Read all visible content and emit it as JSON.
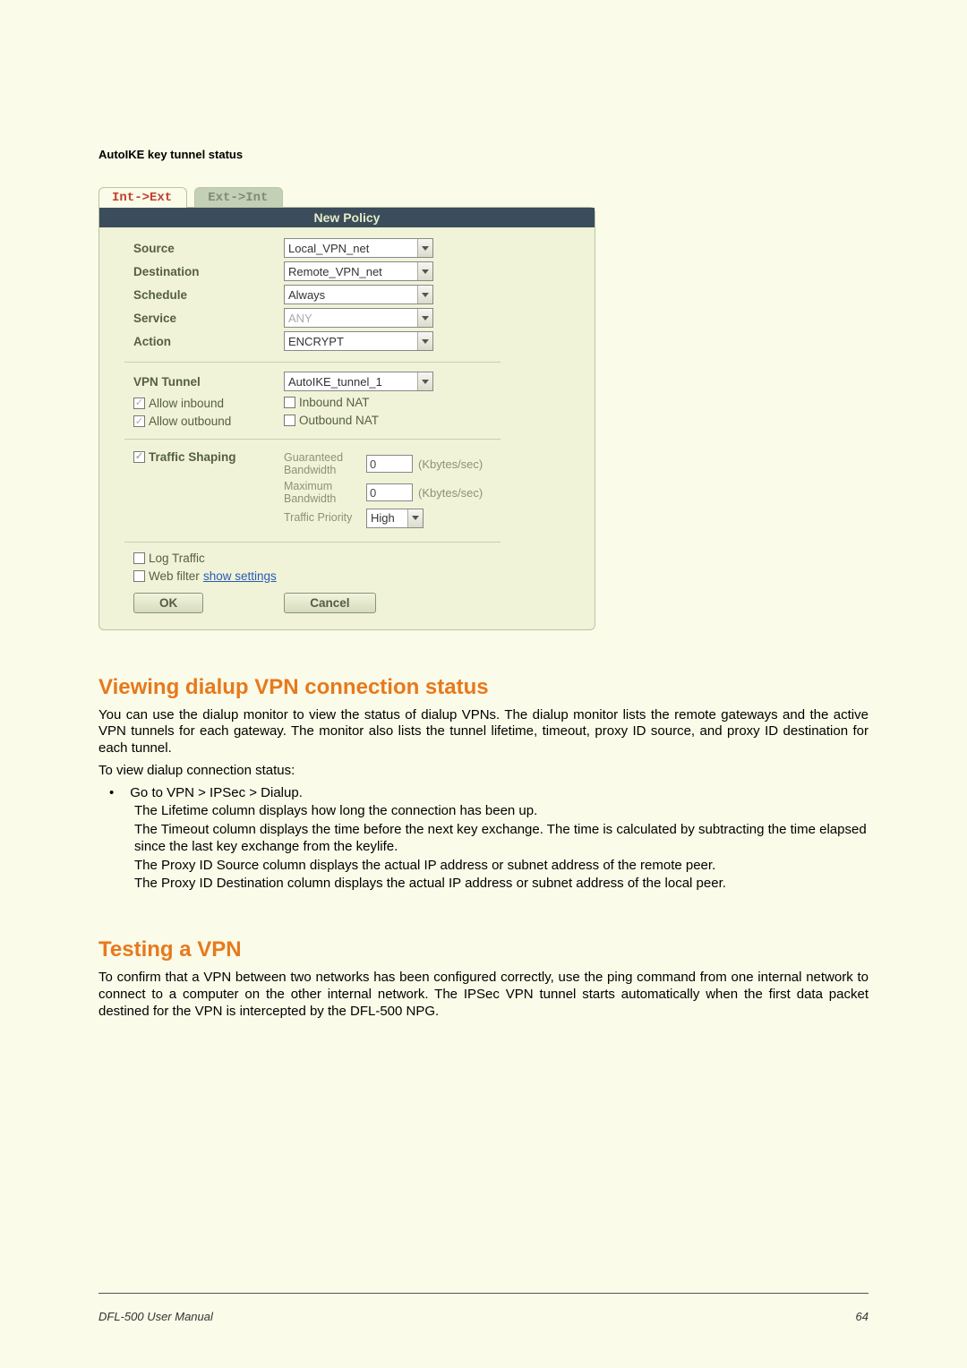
{
  "caption": "AutoIKE key tunnel status",
  "tabs": {
    "active": "Int->Ext",
    "inactive": "Ext->Int"
  },
  "panel_title": "New Policy",
  "fields": {
    "source": {
      "label": "Source",
      "value": "Local_VPN_net"
    },
    "destination": {
      "label": "Destination",
      "value": "Remote_VPN_net"
    },
    "schedule": {
      "label": "Schedule",
      "value": "Always"
    },
    "service": {
      "label": "Service",
      "value": "ANY"
    },
    "action": {
      "label": "Action",
      "value": "ENCRYPT"
    },
    "vpn_tunnel": {
      "label": "VPN Tunnel",
      "value": "AutoIKE_tunnel_1"
    }
  },
  "checks": {
    "allow_inbound": "Allow inbound",
    "allow_outbound": "Allow outbound",
    "inbound_nat": "Inbound NAT",
    "outbound_nat": "Outbound NAT",
    "traffic_shaping": "Traffic Shaping",
    "log_traffic": "Log Traffic",
    "web_filter": "Web filter"
  },
  "bandwidth": {
    "guaranteed_label": "Guaranteed Bandwidth",
    "guaranteed_value": "0",
    "maximum_label": "Maximum Bandwidth",
    "maximum_value": "0",
    "priority_label": "Traffic Priority",
    "priority_value": "High",
    "unit": "(Kbytes/sec)"
  },
  "show_settings": "show settings",
  "buttons": {
    "ok": "OK",
    "cancel": "Cancel"
  },
  "h2a": "Viewing dialup VPN connection status",
  "p1": "You can use the dialup monitor to view the status of dialup VPNs. The dialup monitor lists the remote gateways and the active VPN tunnels for each gateway. The monitor also lists the tunnel lifetime, timeout, proxy ID source, and proxy ID destination for each tunnel.",
  "p2": "To view dialup connection status:",
  "li1": "Go to VPN > IPSec > Dialup.",
  "sub1": "The Lifetime column displays how long the connection has been up.",
  "sub2": "The Timeout column displays the time before the next key exchange. The time is calculated by subtracting the time elapsed since the last key exchange from the keylife.",
  "sub3": "The Proxy ID Source column displays the actual IP address or subnet address of the remote peer.",
  "sub4": "The Proxy ID Destination column displays the actual IP address or subnet address of the local peer.",
  "h2b": "Testing a VPN",
  "p3": "To confirm that a VPN between two networks has been configured correctly, use the ping command from one internal network to connect to a computer on the other internal network. The IPSec VPN tunnel starts automatically when the first data packet destined for the VPN is intercepted by the DFL-500 NPG.",
  "footer_left": "DFL-500 User Manual",
  "footer_right": "64"
}
